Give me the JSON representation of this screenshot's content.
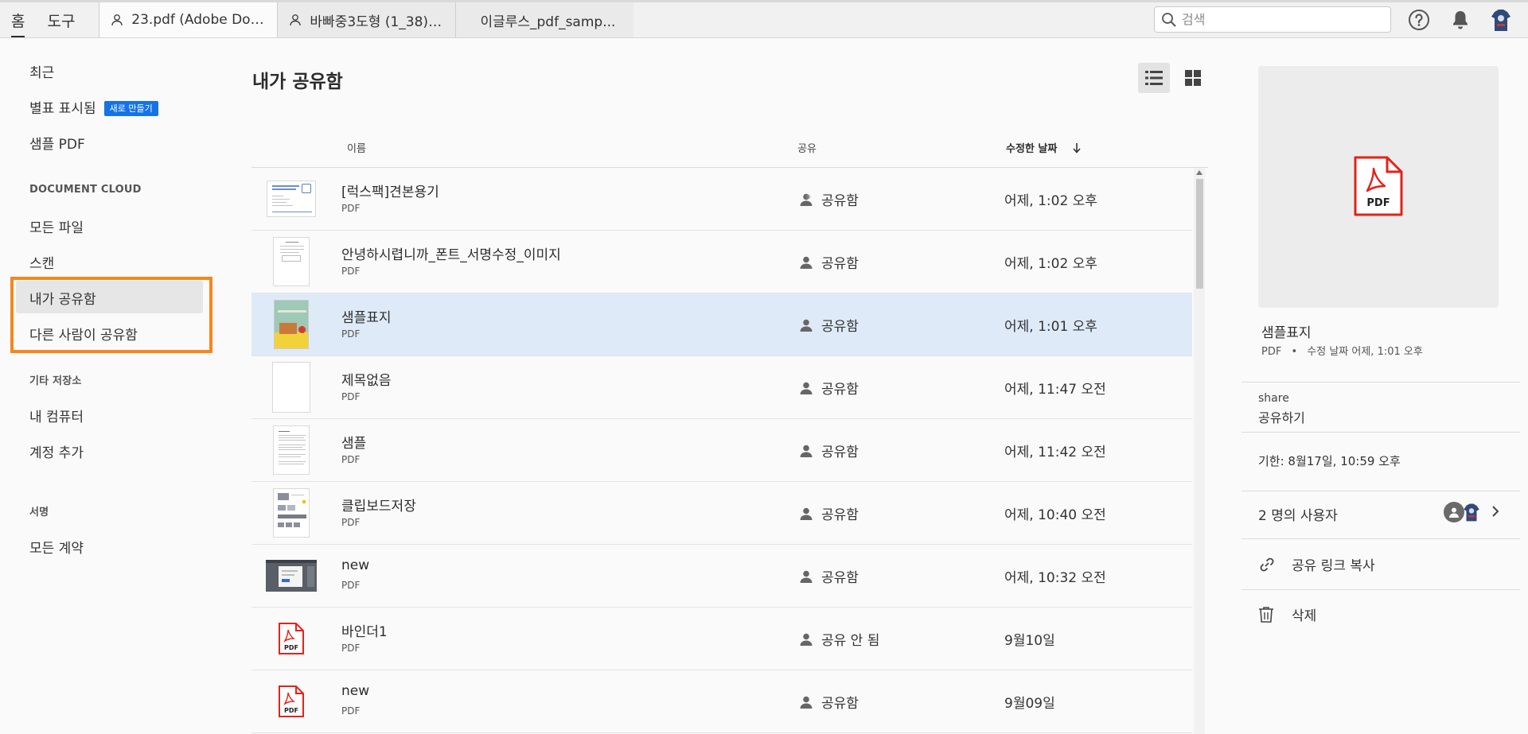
{
  "topbar": {
    "main_tabs": [
      "홈",
      "도구"
    ],
    "doc_tabs": [
      "23.pdf (Adobe Doc...",
      "바빠중3도형 (1_38)_...",
      "이글루스_pdf_samp..."
    ],
    "search_placeholder": "검색"
  },
  "sidebar": {
    "recent": "최근",
    "starred": "별표 표시됨",
    "new_badge": "새로 만들기",
    "sample_pdf": "샘플 PDF",
    "section_cloud": "DOCUMENT CLOUD",
    "all_files": "모든 파일",
    "scan": "스캔",
    "shared_by_me": "내가 공유함",
    "shared_by_others": "다른 사람이 공유함",
    "section_other": "기타 저장소",
    "my_computer": "내 컴퓨터",
    "add_account": "계정 추가",
    "section_sign": "서명",
    "all_agreements": "모든 계약"
  },
  "main": {
    "title": "내가 공유함",
    "columns": {
      "name": "이름",
      "share": "공유",
      "modified": "수정한 날짜"
    },
    "rows": [
      {
        "name": "[럭스팩]견본용기",
        "type": "PDF",
        "share": "공유함",
        "date": "어제, 1:02 오후",
        "thumb": "doc-wide"
      },
      {
        "name": "안녕하시렵니까_폰트_서명수정_이미지",
        "type": "PDF",
        "share": "공유함",
        "date": "어제, 1:02 오후",
        "thumb": "doc"
      },
      {
        "name": "샘플표지",
        "type": "PDF",
        "share": "공유함",
        "date": "어제, 1:01 오후",
        "thumb": "cover"
      },
      {
        "name": "제목없음",
        "type": "PDF",
        "share": "공유함",
        "date": "어제, 11:47 오전",
        "thumb": "blank"
      },
      {
        "name": "샘플",
        "type": "PDF",
        "share": "공유함",
        "date": "어제, 11:42 오전",
        "thumb": "text"
      },
      {
        "name": "클립보드저장",
        "type": "PDF",
        "share": "공유함",
        "date": "어제, 10:40 오전",
        "thumb": "images"
      },
      {
        "name": "new",
        "type": "PDF",
        "share": "공유함",
        "date": "어제, 10:32 오전",
        "thumb": "screen"
      },
      {
        "name": "바인더1",
        "type": "PDF",
        "share": "공유 안 됨",
        "date": "9월10일",
        "thumb": "pdf-icon"
      },
      {
        "name": "new",
        "type": "PDF",
        "share": "공유함",
        "date": "9월09일",
        "thumb": "pdf-icon"
      }
    ]
  },
  "right_panel": {
    "preview_icon_label": "PDF",
    "file_name": "샘플표지",
    "file_type": "PDF",
    "meta_separator": "•",
    "meta_modified": "수정 날짜 어제, 1:01 오후",
    "share_label": "share",
    "share_action": "공유하기",
    "expiry": "기한: 8월17일, 10:59 오후",
    "users": "2 명의 사용자",
    "copy_link": "공유 링크 복사",
    "delete": "삭제"
  },
  "colors": {
    "accent_blue": "#1473e6",
    "highlight_orange": "#f7861e",
    "pdf_red": "#e2231a",
    "selected_row": "#dfeaf8"
  }
}
